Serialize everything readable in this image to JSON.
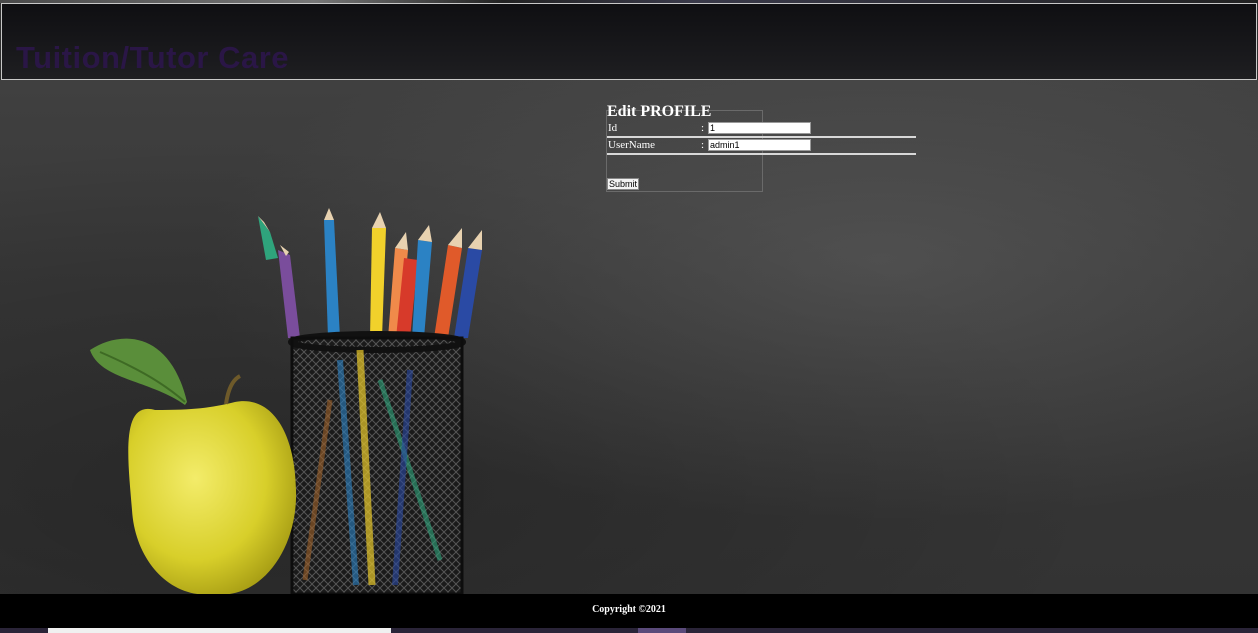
{
  "header": {
    "site_title": "Tuition/Tutor Care"
  },
  "form": {
    "title": "Edit PROFILE",
    "fields": [
      {
        "label": "Id",
        "separator": ":",
        "value": "1"
      },
      {
        "label": "UserName",
        "separator": ":",
        "value": "admin1"
      }
    ],
    "submit_label": "Submit"
  },
  "footer": {
    "copyright": "Copyright ©2021"
  },
  "colors": {
    "title_color": "#2a1646",
    "footer_bg": "#000000",
    "board_bg": "#383838"
  }
}
